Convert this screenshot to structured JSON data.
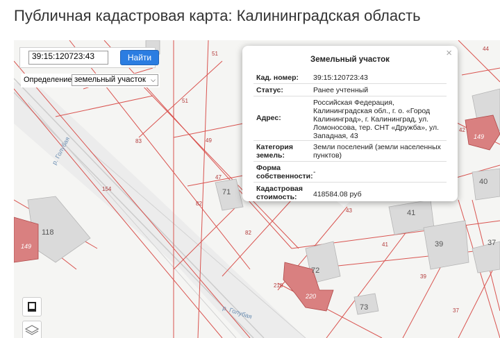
{
  "page": {
    "title": "Публичная кадастровая карта: Калининградская область"
  },
  "search": {
    "value": "39:15:120723:43",
    "button_label": "Найти"
  },
  "definition": {
    "label": "Определение:",
    "selected": "земельный участок"
  },
  "popup": {
    "title": "Земельный участок",
    "close": "×",
    "rows": [
      {
        "label": "Кад. номер:",
        "value": "39:15:120723:43"
      },
      {
        "label": "Статус:",
        "value": "Ранее учтенный"
      },
      {
        "label": "Адрес:",
        "value": "Российская Федерация, Калининградская обл., г. о. «Город Калининград», г. Калининград, ул. Ломоносова, тер. СНТ «Дружба», ул. Западная, 43"
      },
      {
        "label": "Категория земель:",
        "value": "Земли поселений (земли населенных пунктов)"
      },
      {
        "label": "Форма собственности:",
        "value": "-"
      },
      {
        "label": "Кадастровая стоимость:",
        "value": "418584.08 руб"
      }
    ]
  },
  "map": {
    "street_name": "р. Голубая",
    "parcel_labels": [
      "51",
      "51",
      "83",
      "49",
      "154",
      "47",
      "71",
      "82",
      "82",
      "44",
      "42",
      "149",
      "118",
      "149",
      "40",
      "41",
      "39",
      "37",
      "41",
      "39",
      "43",
      "218",
      "220",
      "72",
      "73",
      "37"
    ],
    "building_numbers": [
      "149",
      "220",
      "72",
      "73",
      "41",
      "39",
      "40",
      "37"
    ]
  },
  "colors": {
    "parcel_line": "#d9534f",
    "building_fill": "#d98080",
    "road": "#e8e8e8",
    "button": "#2b7de1"
  }
}
